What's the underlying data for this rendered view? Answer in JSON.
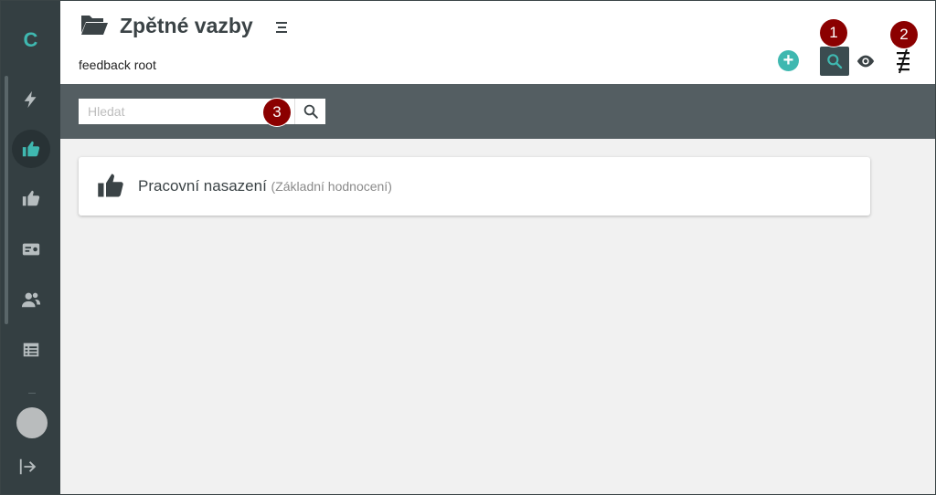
{
  "app": {
    "logo_letter": "C"
  },
  "sidebar": {
    "items": [
      {
        "name": "lightning-icon",
        "active": false
      },
      {
        "name": "thumbs-up-active-icon",
        "active": true
      },
      {
        "name": "thumbs-up-icon",
        "active": false
      },
      {
        "name": "id-card-icon",
        "active": false
      },
      {
        "name": "users-icon",
        "active": false
      },
      {
        "name": "table-icon",
        "active": false
      }
    ]
  },
  "header": {
    "title": "Zpětné vazby",
    "breadcrumb": "feedback root"
  },
  "badges": {
    "b1": "1",
    "b2": "2",
    "b3": "3"
  },
  "search": {
    "placeholder": "Hledat",
    "value": ""
  },
  "cards": [
    {
      "title": "Pracovní nasazení",
      "subtitle": "(Základní hodnocení)"
    }
  ],
  "colors": {
    "accent": "#3fb8b0",
    "sidebar": "#343f42",
    "badge": "#8b0000"
  }
}
